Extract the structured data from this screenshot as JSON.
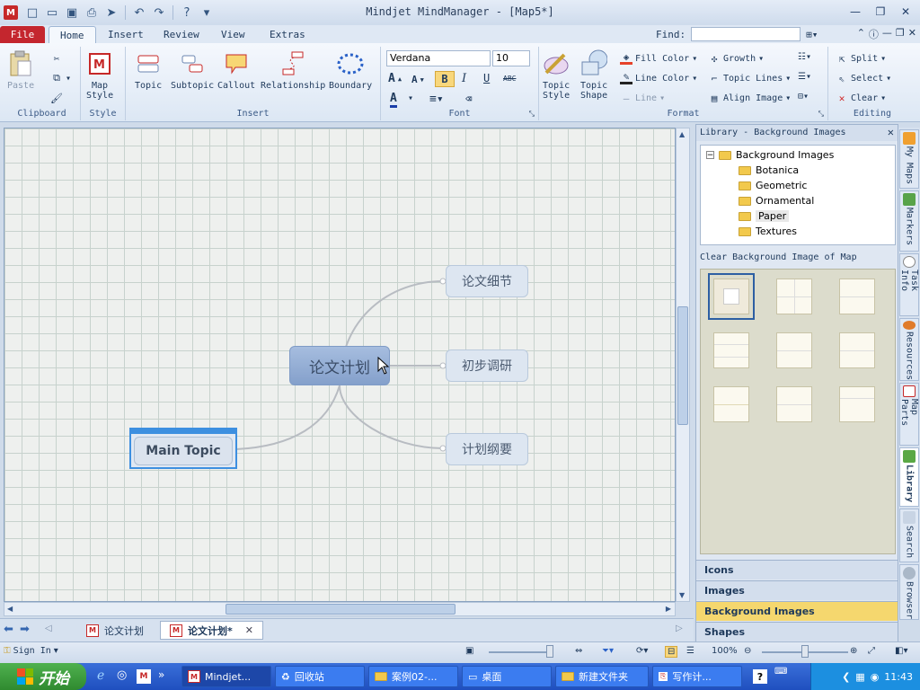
{
  "window": {
    "title": "Mindjet MindManager - [Map5*]",
    "app_badge": "M"
  },
  "ribbon_tabs": [
    {
      "label": "File"
    },
    {
      "label": "Home"
    },
    {
      "label": "Insert"
    },
    {
      "label": "Review"
    },
    {
      "label": "View"
    },
    {
      "label": "Extras"
    }
  ],
  "find": {
    "label": "Find:",
    "value": ""
  },
  "ribbon": {
    "clipboard": {
      "paste": "Paste",
      "group": "Clipboard"
    },
    "style": {
      "map_style_1": "Map",
      "map_style_2": "Style",
      "group": "Style"
    },
    "insert": {
      "topic": "Topic",
      "subtopic": "Subtopic",
      "callout": "Callout",
      "relationship": "Relationship",
      "boundary": "Boundary",
      "group": "Insert"
    },
    "font": {
      "family": "Verdana",
      "size": "10",
      "bold": "B",
      "italic": "I",
      "underline": "U",
      "strike": "ABC",
      "group": "Font"
    },
    "format": {
      "topic_style_1": "Topic",
      "topic_style_2": "Style",
      "topic_shape_1": "Topic",
      "topic_shape_2": "Shape",
      "fill_color": "Fill Color",
      "line_color": "Line Color",
      "line": "Line",
      "growth": "Growth",
      "topic_lines": "Topic Lines",
      "align_image": "Align Image",
      "group": "Format"
    },
    "editing": {
      "split": "Split",
      "select": "Select",
      "clear": "Clear",
      "group": "Editing"
    }
  },
  "map": {
    "central": "论文计划",
    "subtopics": [
      "论文细节",
      "初步调研",
      "计划纲要"
    ],
    "floating": "Main Topic"
  },
  "doc_tabs": [
    {
      "label": "论文计划",
      "active": false
    },
    {
      "label": "论文计划*",
      "active": true
    }
  ],
  "library": {
    "title": "Library - Background Images",
    "tree_root": "Background Images",
    "folders": [
      "Botanica",
      "Geometric",
      "Ornamental",
      "Paper",
      "Textures"
    ],
    "selected_folder": "Paper",
    "clear_label": "Clear Background Image of Map",
    "categories": [
      {
        "label": "Icons",
        "active": false
      },
      {
        "label": "Images",
        "active": false
      },
      {
        "label": "Background Images",
        "active": true
      },
      {
        "label": "Shapes",
        "active": false
      }
    ]
  },
  "side_tabs": [
    "My Maps",
    "Markers",
    "Task Info",
    "Resources",
    "Map Parts",
    "Library",
    "Search",
    "Browser"
  ],
  "statusbar": {
    "sign_in": "Sign In",
    "zoom": "100%"
  },
  "taskbar": {
    "start": "开始",
    "tasks": [
      "Mindjet...",
      "回收站",
      "案例02-...",
      "桌面",
      "新建文件夹",
      "写作计..."
    ],
    "clock": "11:43"
  },
  "colors": {
    "accent_red": "#c4262e",
    "selection_blue": "#3d8fe0",
    "central_topic": "#8ea9d1"
  }
}
